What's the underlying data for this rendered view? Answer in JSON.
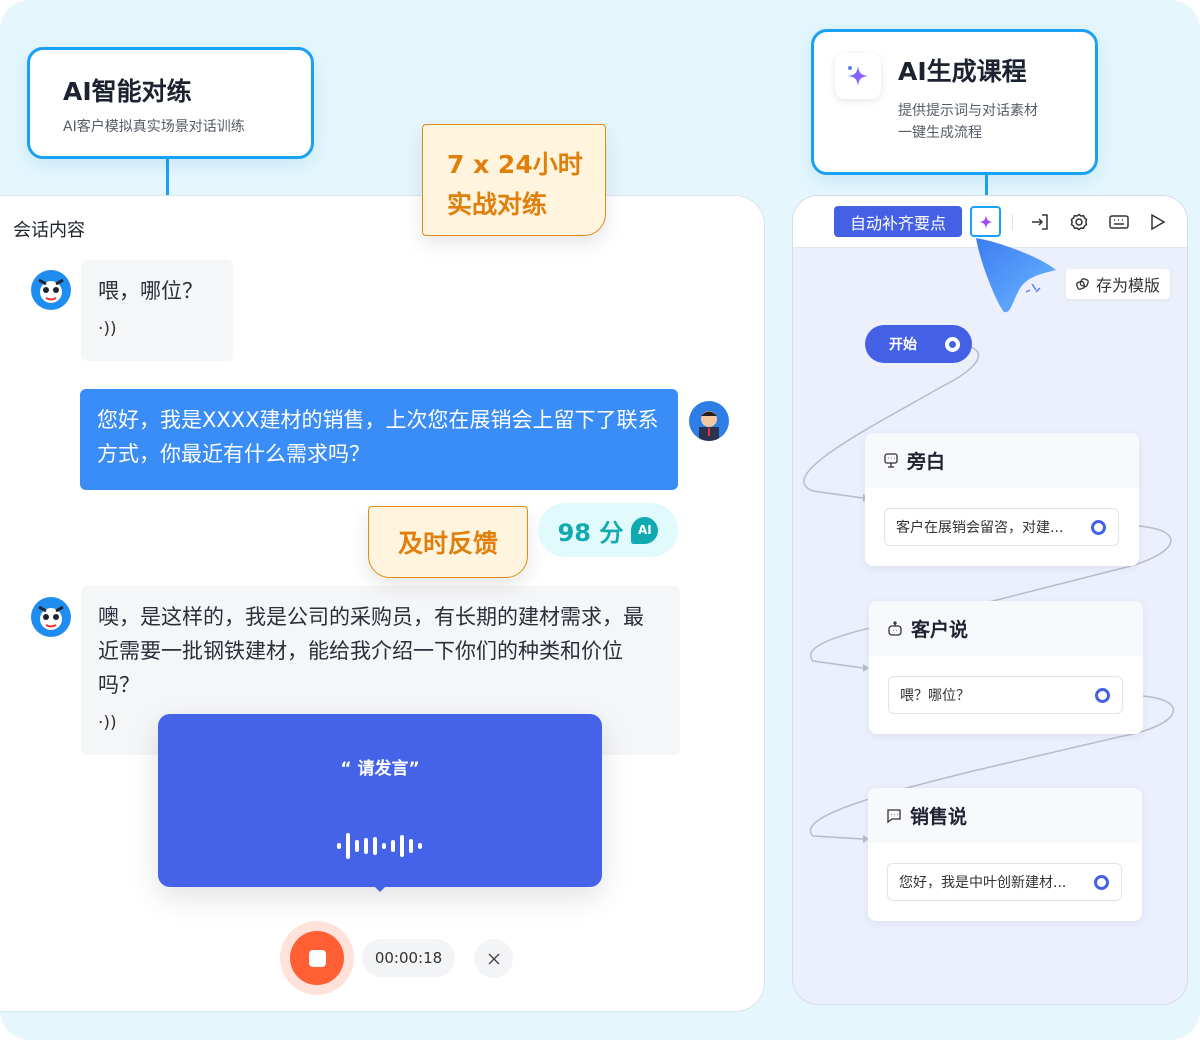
{
  "callout_left": {
    "title": "AI智能对练",
    "subtitle": "AI客户模拟真实场景对话训练"
  },
  "callout_right": {
    "title": "AI生成课程",
    "line1": "提供提示词与对话素材",
    "line2": "一键生成流程",
    "icon": "sparkle-icon"
  },
  "note_24h": {
    "line1": "7 x 24小时",
    "line2": "实战对练"
  },
  "note_feedback": "及时反馈",
  "score": {
    "value": "98 分",
    "badge": "AI"
  },
  "chat": {
    "title": "会话内容",
    "messages": [
      {
        "role": "customer",
        "text": "喂，哪位？",
        "icon": "speaker-icon",
        "speaker": "·))"
      },
      {
        "role": "user",
        "text": "您好，我是XXXX建材的销售，上次您在展销会上留下了联系方式，你最近有什么需求吗？"
      },
      {
        "role": "customer",
        "text": "噢，是这样的，我是公司的采购员，有长期的建材需求，最近需要一批钢铁建材，能给我介绍一下你们的种类和价位吗？",
        "icon": "speaker-icon",
        "speaker": "·))"
      }
    ],
    "voice_prompt": "“ 请发言”",
    "timer": "00:00:18"
  },
  "flow": {
    "toolbar": {
      "auto_fill": "自动补齐要点",
      "save_template": "存为模版"
    },
    "start": "开始",
    "nodes": [
      {
        "title": "旁白",
        "icon": "narration-icon",
        "text": "客户在展销会留咨，对建..."
      },
      {
        "title": "客户说",
        "icon": "robot-icon",
        "text": "喂？哪位？"
      },
      {
        "title": "销售说",
        "icon": "chat-icon",
        "text": "您好，我是中叶创新建材..."
      }
    ]
  },
  "colors": {
    "accent": "#4461e6",
    "callout_border": "#1aa0f4",
    "user_bubble": "#3a8cf6",
    "record": "#ff5f33",
    "note": "#e07f0c",
    "score": "#10aab0"
  }
}
